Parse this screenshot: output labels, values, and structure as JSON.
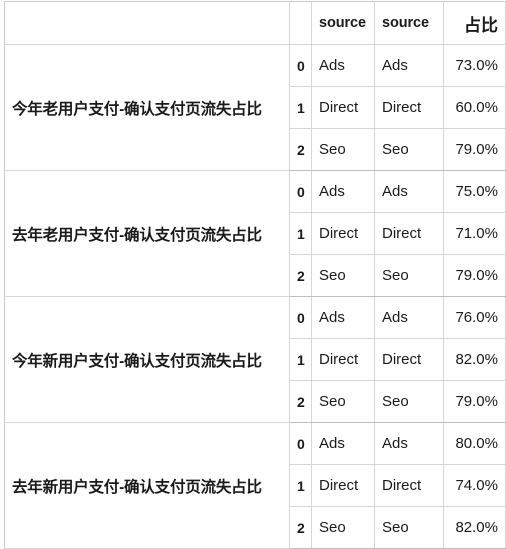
{
  "table": {
    "headers": {
      "group": "",
      "index": "",
      "source_1": "source",
      "source_2": "source",
      "ratio": "占比"
    },
    "groups": [
      {
        "label": "今年老用户支付-确认支付页流失占比",
        "rows": [
          {
            "index": "0",
            "source_1": "Ads",
            "source_2": "Ads",
            "ratio": "73.0%"
          },
          {
            "index": "1",
            "source_1": "Direct",
            "source_2": "Direct",
            "ratio": "60.0%"
          },
          {
            "index": "2",
            "source_1": "Seo",
            "source_2": "Seo",
            "ratio": "79.0%"
          }
        ]
      },
      {
        "label": "去年老用户支付-确认支付页流失占比",
        "rows": [
          {
            "index": "0",
            "source_1": "Ads",
            "source_2": "Ads",
            "ratio": "75.0%"
          },
          {
            "index": "1",
            "source_1": "Direct",
            "source_2": "Direct",
            "ratio": "71.0%"
          },
          {
            "index": "2",
            "source_1": "Seo",
            "source_2": "Seo",
            "ratio": "79.0%"
          }
        ]
      },
      {
        "label": "今年新用户支付-确认支付页流失占比",
        "rows": [
          {
            "index": "0",
            "source_1": "Ads",
            "source_2": "Ads",
            "ratio": "76.0%"
          },
          {
            "index": "1",
            "source_1": "Direct",
            "source_2": "Direct",
            "ratio": "82.0%"
          },
          {
            "index": "2",
            "source_1": "Seo",
            "source_2": "Seo",
            "ratio": "79.0%"
          }
        ]
      },
      {
        "label": "去年新用户支付-确认支付页流失占比",
        "rows": [
          {
            "index": "0",
            "source_1": "Ads",
            "source_2": "Ads",
            "ratio": "80.0%"
          },
          {
            "index": "1",
            "source_1": "Direct",
            "source_2": "Direct",
            "ratio": "74.0%"
          },
          {
            "index": "2",
            "source_1": "Seo",
            "source_2": "Seo",
            "ratio": "82.0%"
          }
        ]
      }
    ]
  },
  "colors": {
    "border": "#d6d6d6",
    "border_strong": "#bdbdbd",
    "text": "#1a1a1a",
    "background": "#ffffff"
  }
}
